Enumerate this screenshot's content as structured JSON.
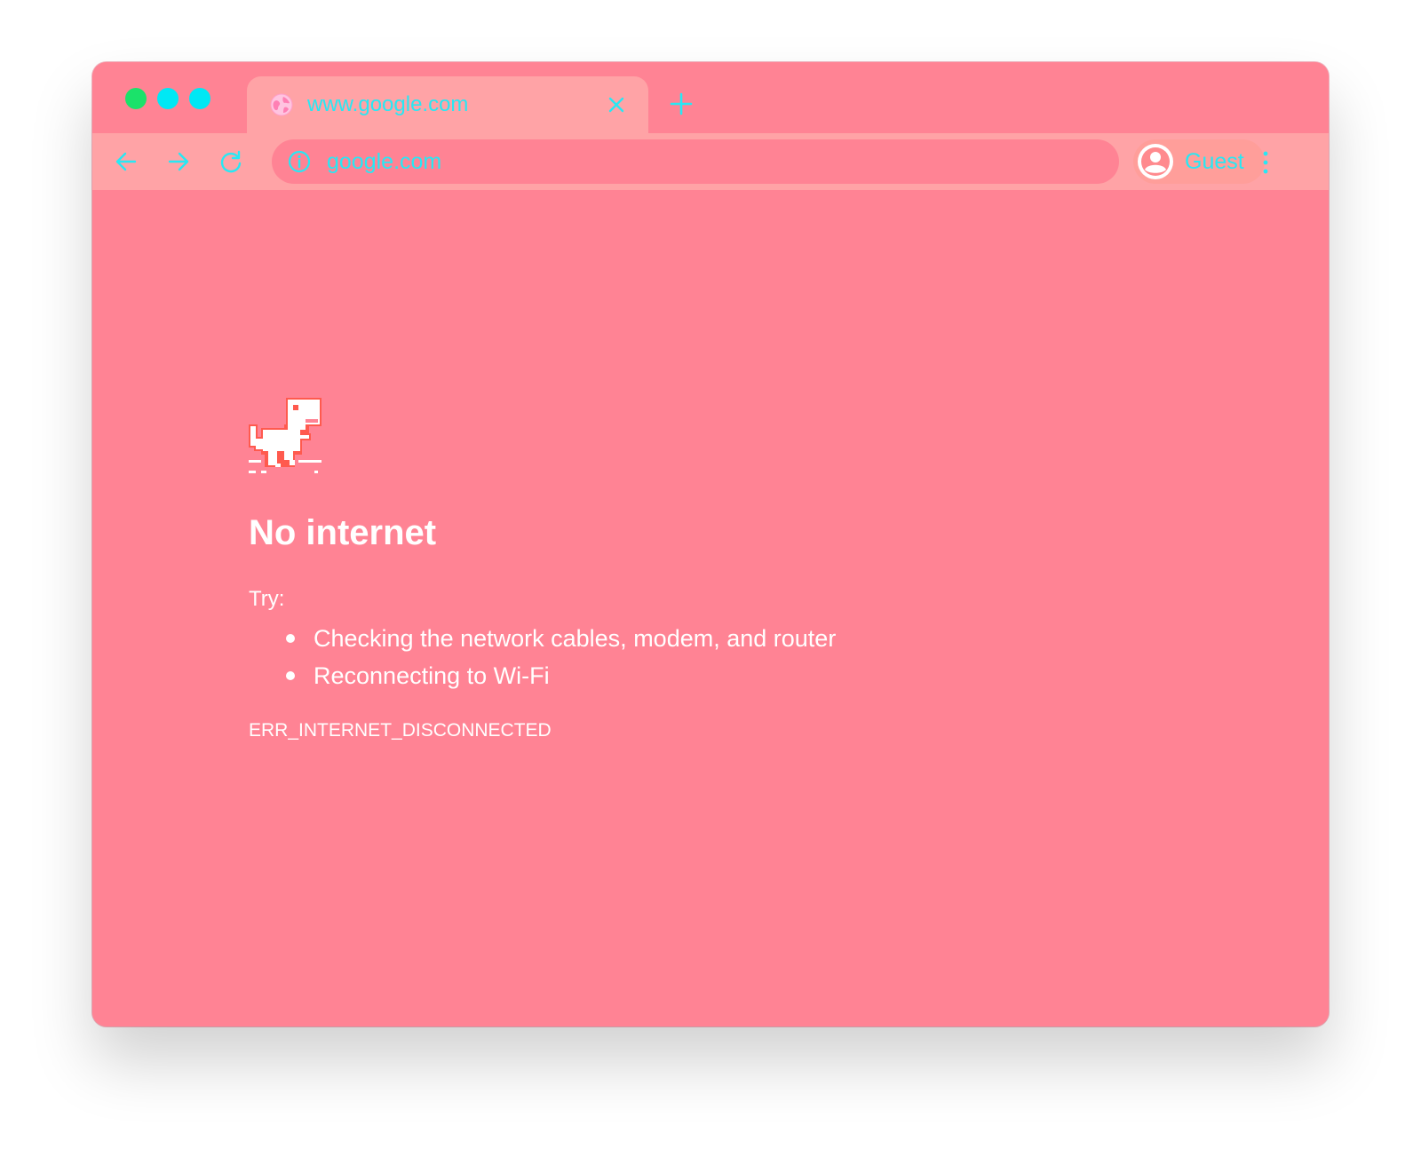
{
  "colors": {
    "page_background": "#ff8394",
    "toolbar_background": "#ffa3a6",
    "accent_cyan": "#27e8f4",
    "traffic_light_close": "#1be26a",
    "traffic_light_minimize": "#00e8f4",
    "traffic_light_maximize": "#00e8f4",
    "text_white": "#ffffff"
  },
  "tab": {
    "icon": "globe-icon",
    "title": "www.google.com",
    "close_icon": "close-icon"
  },
  "toolbar": {
    "back_icon": "back-arrow-icon",
    "forward_icon": "forward-arrow-icon",
    "reload_icon": "reload-icon",
    "url_icon": "info-icon",
    "url": "google.com",
    "profile_icon": "avatar-icon",
    "profile_label": "Guest",
    "menu_icon": "vertical-dots-icon"
  },
  "new_tab_icon": "plus-icon",
  "error_page": {
    "illustration": "dinosaur-icon",
    "heading": "No internet",
    "try_label": "Try:",
    "suggestions": [
      "Checking the network cables, modem, and router",
      "Reconnecting to Wi-Fi"
    ],
    "error_code": "ERR_INTERNET_DISCONNECTED"
  }
}
